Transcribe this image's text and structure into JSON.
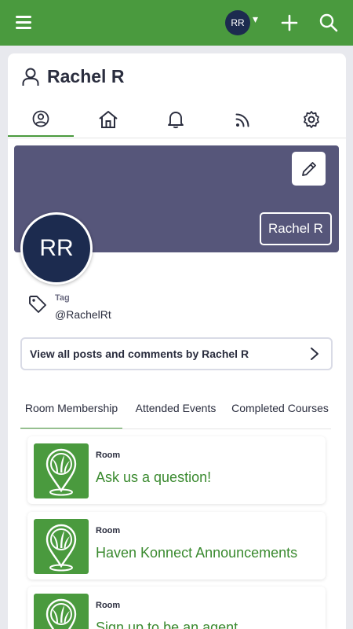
{
  "header": {
    "avatar_initials": "RR",
    "caret": "▾"
  },
  "profile": {
    "name": "Rachel R",
    "initials": "RR",
    "banner_name": "Rachel R"
  },
  "tag": {
    "label": "Tag",
    "value": "@RachelRt"
  },
  "view_posts_label": "View all posts and comments by Rachel R",
  "subtabs": [
    {
      "label": "Room Membership"
    },
    {
      "label": "Attended Events"
    },
    {
      "label": "Completed Courses"
    }
  ],
  "rooms": [
    {
      "type": "Room",
      "name": "Ask us a question!"
    },
    {
      "type": "Room",
      "name": "Haven Konnect Announcements"
    },
    {
      "type": "Room",
      "name": "Sign up to be an agent"
    }
  ],
  "colors": {
    "brand_green": "#4a9a3e",
    "banner": "#56567a",
    "avatar_navy": "#1c2b4f"
  }
}
